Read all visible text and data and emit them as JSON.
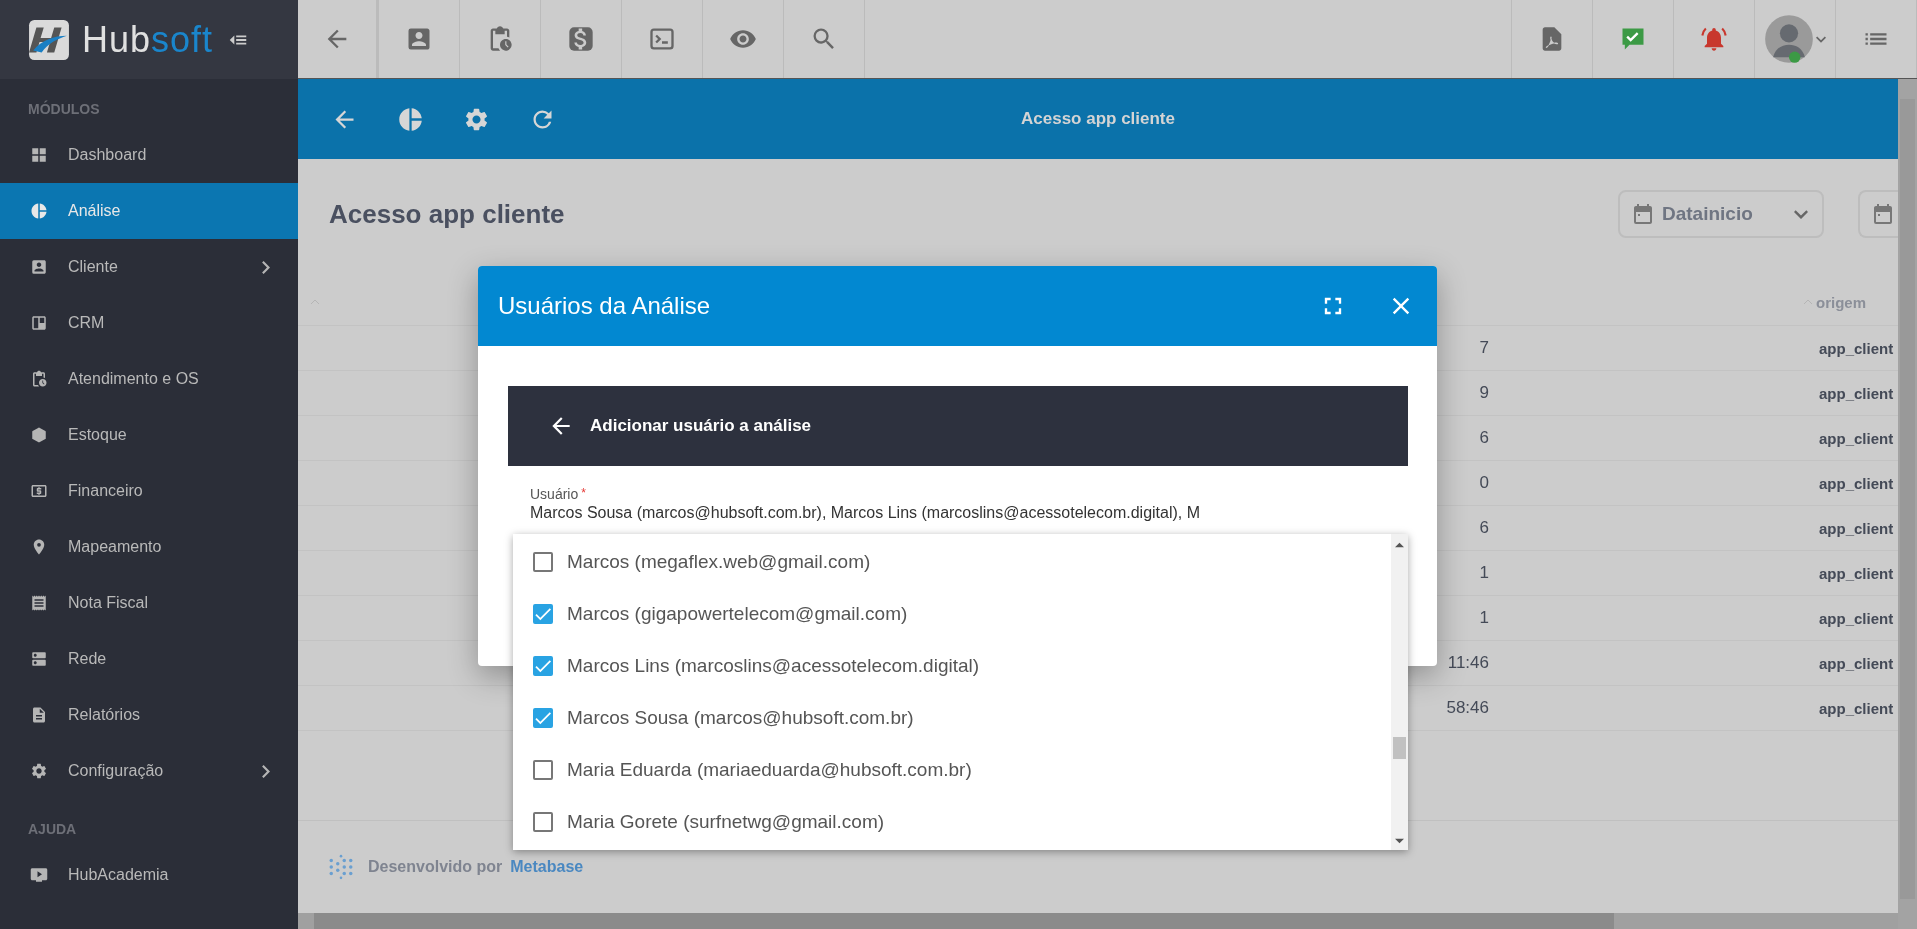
{
  "logo": {
    "part_1": "Hub",
    "part_2": "soft"
  },
  "sidebar": {
    "sections": [
      {
        "title": "MÓDULOS",
        "items": [
          {
            "label": "Dashboard",
            "selected": false,
            "has_submenu": false
          },
          {
            "label": "Análise",
            "selected": true,
            "has_submenu": false
          },
          {
            "label": "Cliente",
            "selected": false,
            "has_submenu": true
          },
          {
            "label": "CRM",
            "selected": false,
            "has_submenu": false
          },
          {
            "label": "Atendimento e OS",
            "selected": false,
            "has_submenu": false
          },
          {
            "label": "Estoque",
            "selected": false,
            "has_submenu": false
          },
          {
            "label": "Financeiro",
            "selected": false,
            "has_submenu": false
          },
          {
            "label": "Mapeamento",
            "selected": false,
            "has_submenu": false
          },
          {
            "label": "Nota Fiscal",
            "selected": false,
            "has_submenu": false
          },
          {
            "label": "Rede",
            "selected": false,
            "has_submenu": false
          },
          {
            "label": "Relatórios",
            "selected": false,
            "has_submenu": false
          },
          {
            "label": "Configuração",
            "selected": false,
            "has_submenu": true
          }
        ]
      },
      {
        "title": "AJUDA",
        "items": [
          {
            "label": "HubAcademia",
            "selected": false,
            "has_submenu": false
          }
        ]
      }
    ]
  },
  "toolbar": {
    "title": "Acesso app cliente"
  },
  "page": {
    "heading": "Acesso app cliente",
    "filters": [
      {
        "label": "Datainicio"
      }
    ]
  },
  "table": {
    "columns": [
      {
        "label": "origem"
      }
    ],
    "rows": [
      {
        "column_1": "7",
        "origem": "app_client"
      },
      {
        "column_1": "9",
        "origem": "app_client"
      },
      {
        "column_1": "6",
        "origem": "app_client"
      },
      {
        "column_1": "0",
        "origem": "app_client"
      },
      {
        "column_1": "6",
        "origem": "app_client"
      },
      {
        "column_1": "1",
        "origem": "app_client"
      },
      {
        "column_1": "1",
        "origem": "app_client"
      },
      {
        "column_1": "11:46",
        "origem": "app_client"
      },
      {
        "column_1": "58:46",
        "origem": "app_client"
      }
    ]
  },
  "footer": {
    "prefix": "Desenvolvido por",
    "link": "Metabase"
  },
  "modal": {
    "title": "Usuários da Análise",
    "subheader": "Adicionar usuário a análise",
    "field": {
      "label": "Usuário",
      "required_mark": "*",
      "value": "Marcos Sousa (marcos@hubsoft.com.br), Marcos Lins (marcoslins@acessotelecom.digital), M"
    },
    "options": [
      {
        "label": "Marcos (megaflex.web@gmail.com)",
        "checked": false
      },
      {
        "label": "Marcos (gigapowertelecom@gmail.com)",
        "checked": true
      },
      {
        "label": "Marcos Lins (marcoslins@acessotelecom.digital)",
        "checked": true
      },
      {
        "label": "Marcos Sousa (marcos@hubsoft.com.br)",
        "checked": true
      },
      {
        "label": "Maria Eduarda (mariaeduarda@hubsoft.com.br)",
        "checked": false
      },
      {
        "label": "Maria Gorete (surfnetwg@gmail.com)",
        "checked": false
      }
    ]
  }
}
